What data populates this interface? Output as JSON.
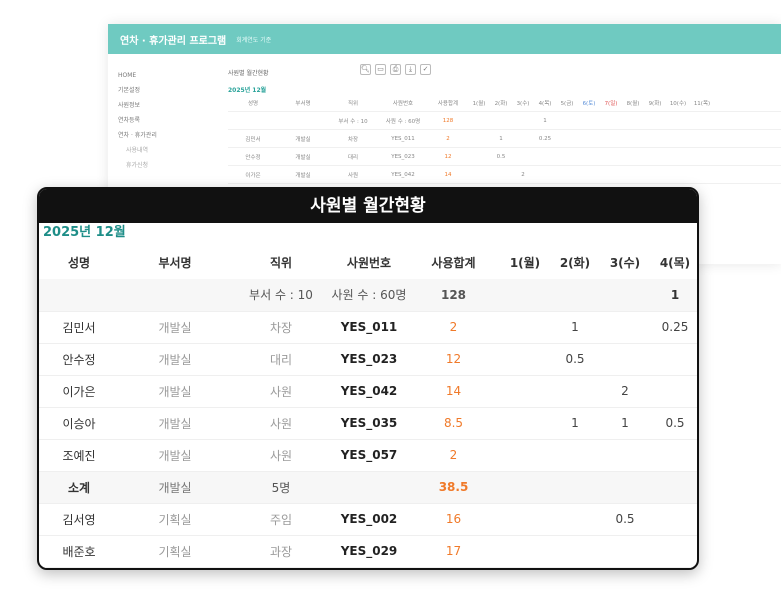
{
  "background": {
    "title": "연차 · 휴가관리 프로그램",
    "subtitle": "회계연도 기준",
    "nav": [
      "HOME",
      "기본설정",
      "사원정보",
      "연차등록",
      "연차 · 휴가관리",
      "사용내역",
      "휴가신청"
    ],
    "report_title": "사원별 월간현황",
    "year_label": "2025년 12월",
    "headers": [
      "성명",
      "부서명",
      "직위",
      "사원번호",
      "사용합계",
      "1(월)",
      "2(화)",
      "3(수)",
      "4(목)",
      "5(금)",
      "6(토)",
      "7(일)",
      "8(월)",
      "9(화)",
      "10(수)",
      "11(목)"
    ],
    "rows": [
      [
        "",
        "",
        "부서 수 : 10",
        "사원 수 : 60명",
        "128",
        "",
        "",
        "",
        "1"
      ],
      [
        "김민서",
        "개발실",
        "차장",
        "YES_011",
        "2",
        "",
        "1",
        "",
        "0.25"
      ],
      [
        "안수정",
        "개발실",
        "대리",
        "YES_023",
        "12",
        "",
        "0.5",
        "",
        ""
      ],
      [
        "이가은",
        "개발실",
        "사원",
        "YES_042",
        "14",
        "",
        "",
        "2",
        ""
      ]
    ]
  },
  "report": {
    "title": "사원별 월간현황",
    "year_month": "2025년 12월",
    "columns": {
      "name": "성명",
      "dept": "부서명",
      "position": "직위",
      "emp_no": "사원번호",
      "total": "사용합계",
      "d1": "1(월)",
      "d2": "2(화)",
      "d3": "3(수)",
      "d4": "4(목)"
    },
    "summary": {
      "dept_count": "부서 수 : 10",
      "emp_count": "사원 수 : 60명",
      "total": "128",
      "d4": "1"
    },
    "rows": [
      {
        "name": "김민서",
        "dept": "개발실",
        "position": "차장",
        "emp_no": "YES_011",
        "total": "2",
        "d1": "",
        "d2": "1",
        "d3": "",
        "d4": "0.25"
      },
      {
        "name": "안수정",
        "dept": "개발실",
        "position": "대리",
        "emp_no": "YES_023",
        "total": "12",
        "d1": "",
        "d2": "0.5",
        "d3": "",
        "d4": ""
      },
      {
        "name": "이가은",
        "dept": "개발실",
        "position": "사원",
        "emp_no": "YES_042",
        "total": "14",
        "d1": "",
        "d2": "",
        "d3": "2",
        "d4": ""
      },
      {
        "name": "이승아",
        "dept": "개발실",
        "position": "사원",
        "emp_no": "YES_035",
        "total": "8.5",
        "d1": "",
        "d2": "1",
        "d3": "1",
        "d4": "0.5"
      },
      {
        "name": "조예진",
        "dept": "개발실",
        "position": "사원",
        "emp_no": "YES_057",
        "total": "2",
        "d1": "",
        "d2": "",
        "d3": "",
        "d4": ""
      }
    ],
    "subtotal": {
      "label": "소계",
      "dept": "개발실",
      "count": "5명",
      "total": "38.5"
    },
    "rows2": [
      {
        "name": "김서영",
        "dept": "기획실",
        "position": "주임",
        "emp_no": "YES_002",
        "total": "16",
        "d1": "",
        "d2": "",
        "d3": "0.5",
        "d4": ""
      },
      {
        "name": "배준호",
        "dept": "기획실",
        "position": "과장",
        "emp_no": "YES_029",
        "total": "17",
        "d1": "",
        "d2": "",
        "d3": "",
        "d4": ""
      }
    ]
  },
  "colors": {
    "accent": "#6fcac1",
    "year": "#1e8e88",
    "total": "#f07a2a",
    "header": "#111111"
  }
}
